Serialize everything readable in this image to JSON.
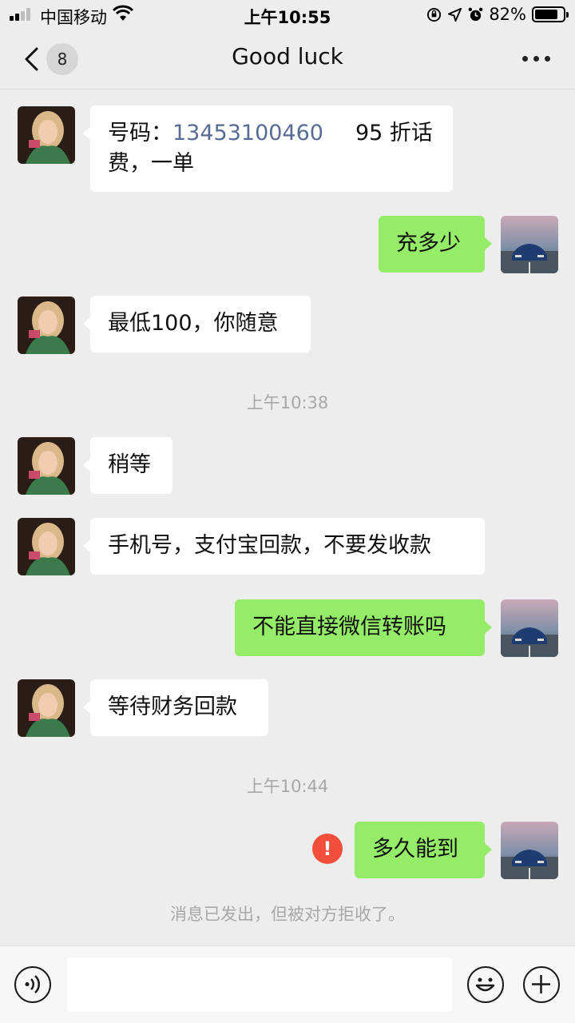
{
  "status_bar": {
    "carrier": "中国移动",
    "time": "上午10:55",
    "battery": "82%",
    "battery_level": 0.82,
    "icons": [
      "signal-icon",
      "wifi-icon",
      "orientation-lock-icon",
      "location-icon",
      "alarm-icon",
      "battery-icon"
    ]
  },
  "nav": {
    "back_badge": "8",
    "title": "Good luck",
    "icons": [
      "chevron-left-icon",
      "more-icon"
    ]
  },
  "messages": [
    {
      "side": "in",
      "phone_label": "号码：",
      "phone": "13453100460",
      "text_after": "95 折话",
      "text_line2": "费，一单"
    },
    {
      "side": "out",
      "text": "充多少"
    },
    {
      "side": "in",
      "text": "最低100，你随意"
    },
    {
      "side": "time",
      "text": "上午10:38"
    },
    {
      "side": "in",
      "text": "稍等"
    },
    {
      "side": "in",
      "text": "手机号，支付宝回款，不要发收款"
    },
    {
      "side": "out",
      "text": "不能直接微信转账吗"
    },
    {
      "side": "in",
      "text": "等待财务回款"
    },
    {
      "side": "time",
      "text": "上午10:44"
    },
    {
      "side": "out",
      "text": "多久能到",
      "status": "failed"
    }
  ],
  "system_note": "消息已发出，但被对方拒收了。",
  "input_bar": {
    "value": "",
    "icons": [
      "voice-icon",
      "emoji-icon",
      "plus-icon"
    ]
  },
  "colors": {
    "background": "#ededed",
    "incoming_bubble": "#ffffff",
    "outgoing_bubble": "#95ec69",
    "link": "#576b95",
    "error": "#f24e3c"
  }
}
